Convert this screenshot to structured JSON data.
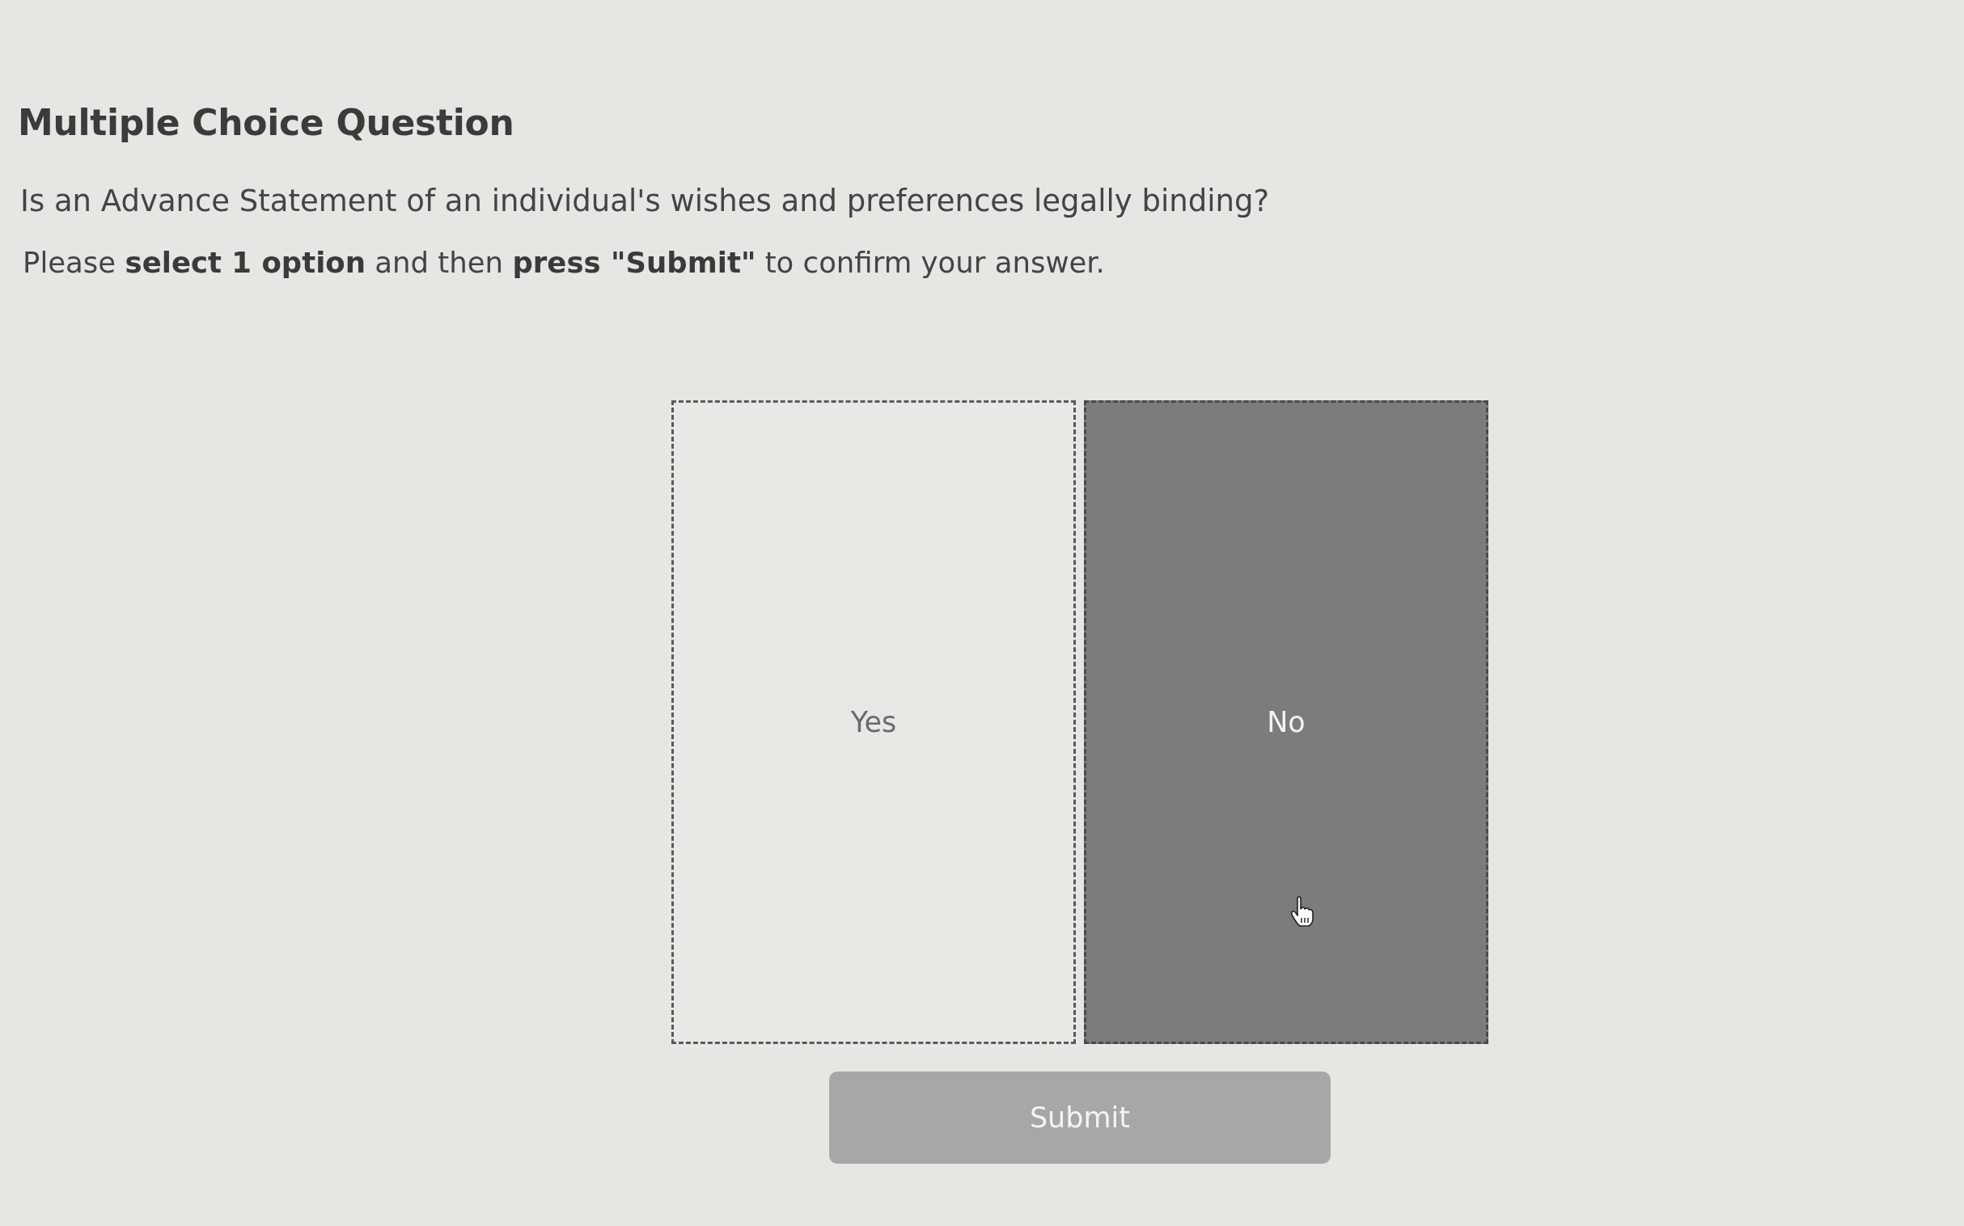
{
  "question": {
    "heading": "Multiple Choice Question",
    "prompt": "Is an Advance Statement of an individual's wishes and preferences legally binding?",
    "instruction": "Please **select 1 option** and then **press \"Submit\"** to confirm your answer."
  },
  "options": [
    {
      "label": "Yes",
      "selected": false
    },
    {
      "label": "No",
      "selected": true
    }
  ],
  "submit": {
    "label": "Submit"
  }
}
